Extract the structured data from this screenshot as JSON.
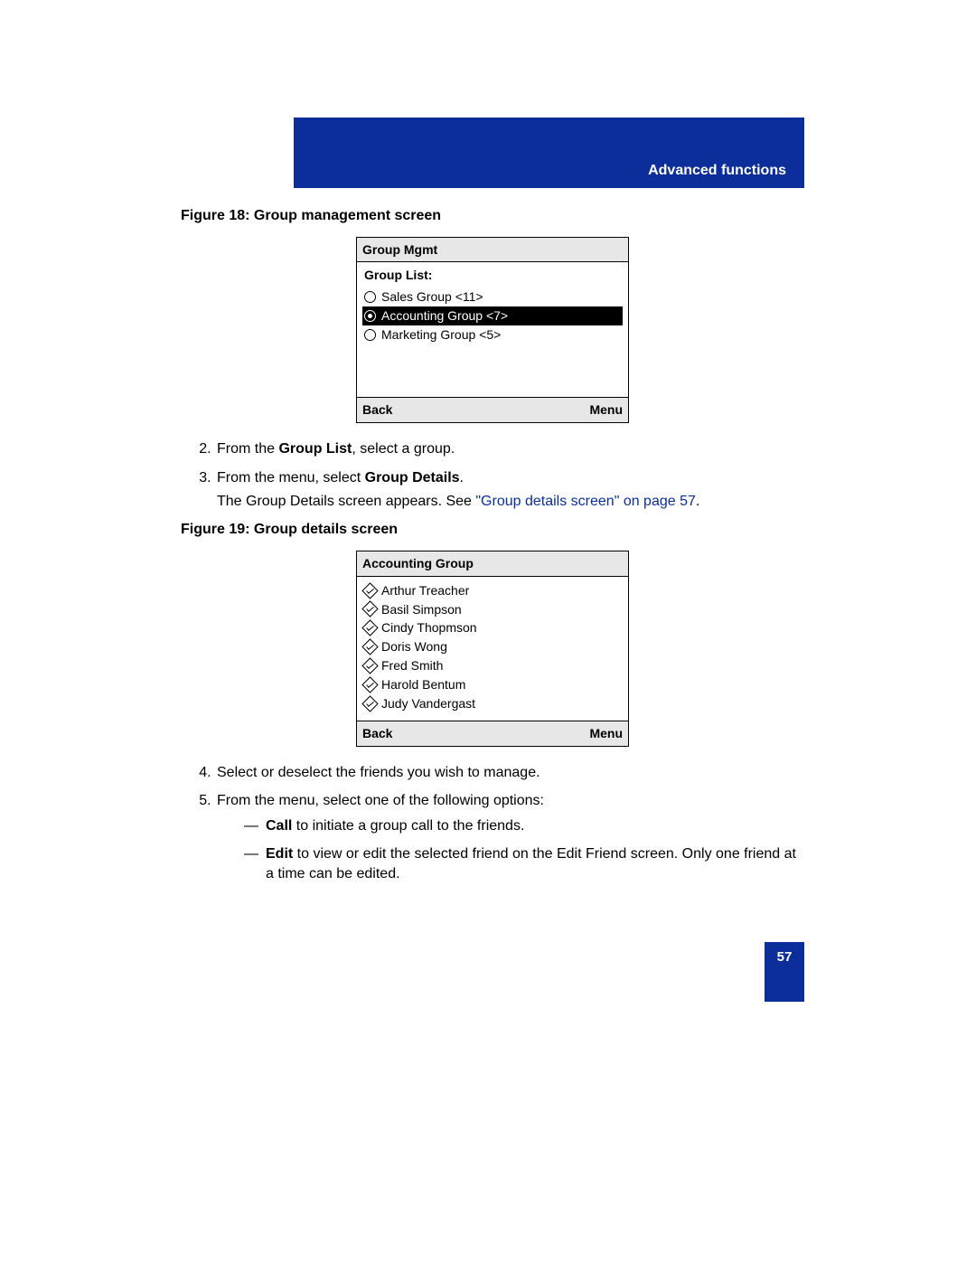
{
  "header": {
    "section_title": "Advanced functions"
  },
  "figure18": {
    "caption": "Figure 18: Group management screen",
    "screen": {
      "title": "Group Mgmt",
      "list_label": "Group List:",
      "items": [
        {
          "label": "Sales Group <11>",
          "selected": false
        },
        {
          "label": "Accounting Group <7>",
          "selected": true
        },
        {
          "label": "Marketing Group <5>",
          "selected": false
        }
      ],
      "softkey_left": "Back",
      "softkey_right": "Menu"
    }
  },
  "steps_a": {
    "s2_pre": "From the ",
    "s2_bold": "Group List",
    "s2_post": ", select a group.",
    "s3_pre": "From the menu, select ",
    "s3_bold": "Group Details",
    "s3_post": ".",
    "s3_note_pre": "The Group Details screen appears. See ",
    "s3_note_link": "\"Group details screen\" on page 57",
    "s3_note_post": "."
  },
  "figure19": {
    "caption": "Figure 19: Group details screen",
    "screen": {
      "title": "Accounting Group",
      "members": [
        "Arthur Treacher",
        "Basil Simpson",
        "Cindy Thopmson",
        "Doris Wong",
        "Fred Smith",
        "Harold Bentum",
        "Judy Vandergast"
      ],
      "softkey_left": "Back",
      "softkey_right": "Menu"
    }
  },
  "steps_b": {
    "s4": "Select or deselect the friends you wish to manage.",
    "s5": "From the menu, select one of the following options:",
    "opt1_bold": "Call",
    "opt1_post": " to initiate a group call to the friends.",
    "opt2_bold": "Edit",
    "opt2_post": " to view or edit the selected friend on the Edit Friend screen. Only one friend at a time can be edited."
  },
  "page_number": "57"
}
